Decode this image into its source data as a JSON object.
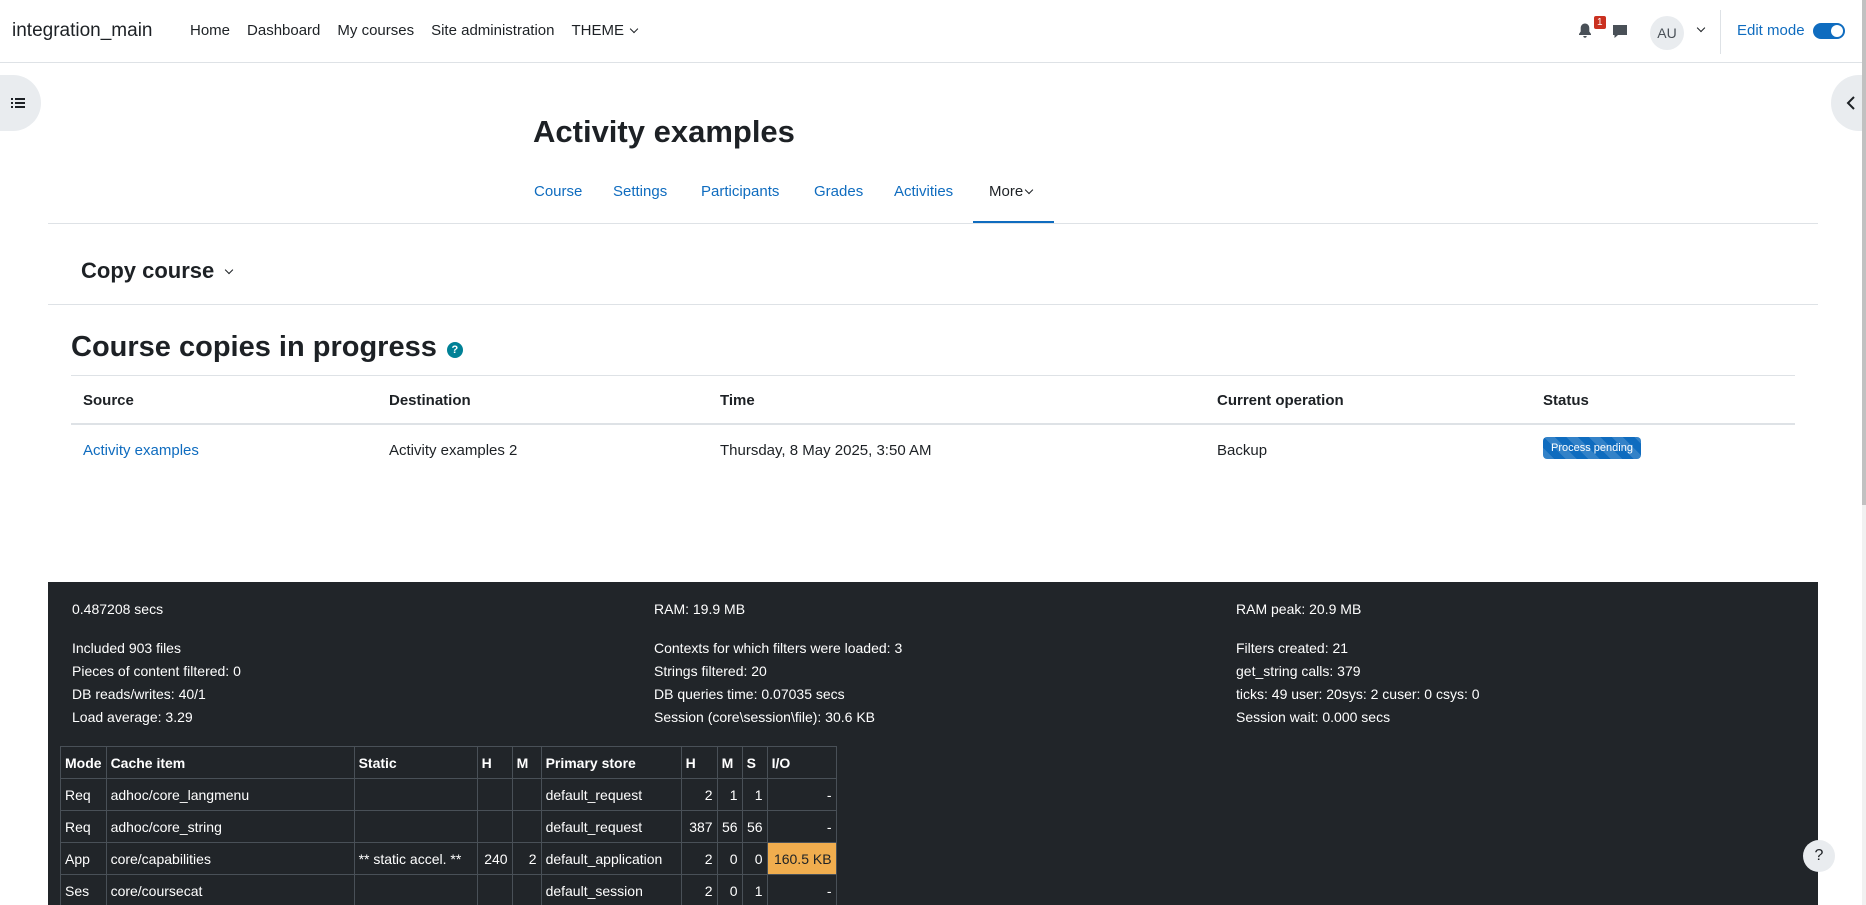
{
  "navbar": {
    "site_name": "integration_main",
    "items": [
      "Home",
      "Dashboard",
      "My courses",
      "Site administration"
    ],
    "theme_label": "THEME",
    "notification_count": "1",
    "user_initials": "AU",
    "edit_mode_label": "Edit mode"
  },
  "header": {
    "title": "Activity examples",
    "tabs": [
      "Course",
      "Settings",
      "Participants",
      "Grades",
      "Activities"
    ],
    "more_label": "More",
    "active_tab": "More"
  },
  "page": {
    "action_heading": "Copy course",
    "section_title": "Course copies in progress",
    "help_icon_text": "?"
  },
  "table": {
    "columns": [
      "Source",
      "Destination",
      "Time",
      "Current operation",
      "Status"
    ],
    "rows": [
      {
        "source": "Activity examples",
        "destination": "Activity examples 2",
        "time": "Thursday, 8 May 2025, 3:50 AM",
        "operation": "Backup",
        "status": "Process pending"
      }
    ]
  },
  "performance": {
    "col1": [
      "0.487208 secs",
      "Included 903 files",
      "Pieces of content filtered: 0",
      "DB reads/writes: 40/1",
      "Load average: 3.29"
    ],
    "col2": [
      "RAM: 19.9 MB",
      "Contexts for which filters were loaded: 3",
      "Strings filtered: 20",
      "DB queries time: 0.07035 secs",
      "Session (core\\session\\file): 30.6 KB"
    ],
    "col3": [
      "RAM peak: 20.9 MB",
      "Filters created: 21",
      "get_string calls: 379",
      "ticks: 49 user: 20sys: 2 cuser: 0 csys: 0",
      "Session wait: 0.000 secs"
    ],
    "cache_columns": [
      "Mode",
      "Cache item",
      "Static",
      "H",
      "M",
      "Primary store",
      "H",
      "M",
      "S",
      "I/O"
    ],
    "cache_rows": [
      [
        "Req",
        "adhoc/core_langmenu",
        "",
        "",
        "",
        "default_request",
        "2",
        "1",
        "1",
        "-"
      ],
      [
        "Req",
        "adhoc/core_string",
        "",
        "",
        "",
        "default_request",
        "387",
        "56",
        "56",
        "-"
      ],
      [
        "App",
        "core/capabilities",
        "** static accel. **",
        "240",
        "2",
        "default_application",
        "2",
        "0",
        "0",
        "160.5 KB"
      ],
      [
        "Ses",
        "core/coursecat",
        "",
        "",
        "",
        "default_session",
        "2",
        "0",
        "1",
        "-"
      ]
    ]
  },
  "colors": {
    "brand_blue": "#0f6cbf",
    "footer_bg": "#212529",
    "io_highlight": "#f0ad4e",
    "badge_red": "#ca3120"
  },
  "help_button_label": "?"
}
